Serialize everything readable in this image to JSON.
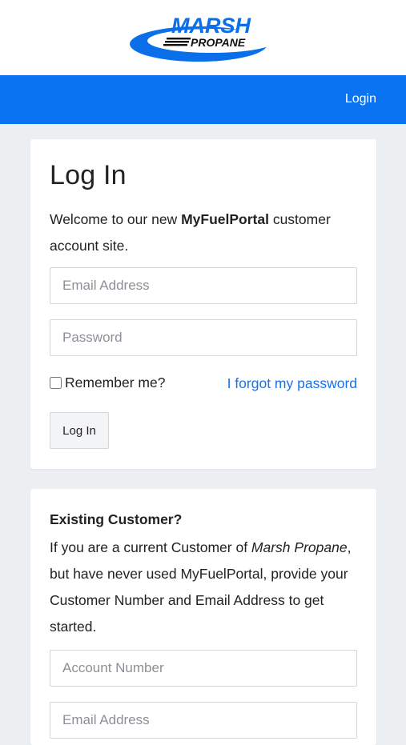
{
  "brand": {
    "logo_line1": "MARSH",
    "logo_line2": "PROPANE",
    "colors": {
      "primary": "#0a73f2",
      "link": "#1a73e8",
      "background": "#eceff2"
    }
  },
  "nav": {
    "login_label": "Login"
  },
  "login_card": {
    "title": "Log In",
    "welcome_pre": "Welcome to our new ",
    "welcome_brand": "MyFuelPortal",
    "welcome_post": " customer account site.",
    "email_placeholder": "Email Address",
    "password_placeholder": "Password",
    "remember_label": "Remember me?",
    "forgot_label": "I forgot my password",
    "submit_label": "Log In"
  },
  "existing_card": {
    "title": "Existing Customer?",
    "text_pre": "If you are a current Customer of ",
    "text_company": "Marsh Propane",
    "text_post": ", but have never used MyFuelPortal, provide your Customer Number and Email Address to get started.",
    "account_placeholder": "Account Number",
    "email_placeholder": "Email Address"
  }
}
